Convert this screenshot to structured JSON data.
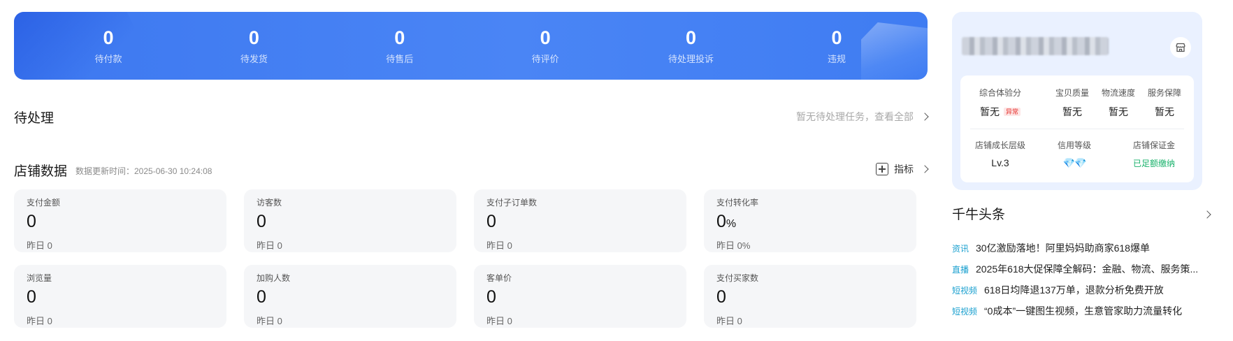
{
  "banner": {
    "items": [
      {
        "value": "0",
        "label": "待付款"
      },
      {
        "value": "0",
        "label": "待发货"
      },
      {
        "value": "0",
        "label": "待售后"
      },
      {
        "value": "0",
        "label": "待评价"
      },
      {
        "value": "0",
        "label": "待处理投诉"
      },
      {
        "value": "0",
        "label": "违规"
      }
    ]
  },
  "pending": {
    "title": "待处理",
    "link": "暂无待处理任务，查看全部"
  },
  "store": {
    "title": "店铺数据",
    "update_time": "数据更新时间：2025-06-30 10:24:08",
    "metric_link": "指标",
    "cards": [
      {
        "label": "支付金额",
        "value": "0",
        "unit": "",
        "yesterday": "昨日 0"
      },
      {
        "label": "访客数",
        "value": "0",
        "unit": "",
        "yesterday": "昨日 0"
      },
      {
        "label": "支付子订单数",
        "value": "0",
        "unit": "",
        "yesterday": "昨日 0"
      },
      {
        "label": "支付转化率",
        "value": "0",
        "unit": "%",
        "yesterday": "昨日 0%"
      },
      {
        "label": "浏览量",
        "value": "0",
        "unit": "",
        "yesterday": "昨日 0"
      },
      {
        "label": "加购人数",
        "value": "0",
        "unit": "",
        "yesterday": "昨日 0"
      },
      {
        "label": "客单价",
        "value": "0",
        "unit": "",
        "yesterday": "昨日 0"
      },
      {
        "label": "支付买家数",
        "value": "0",
        "unit": "",
        "yesterday": "昨日 0"
      }
    ]
  },
  "shop": {
    "icon": "shop-icon",
    "scores_row1": [
      {
        "label": "综合体验分",
        "value": "暂无",
        "tag": "异常"
      },
      {
        "label": "宝贝质量",
        "value": "暂无"
      },
      {
        "label": "物流速度",
        "value": "暂无"
      },
      {
        "label": "服务保障",
        "value": "暂无"
      }
    ],
    "scores_row2": [
      {
        "label": "店铺成长层级",
        "value": "Lv.3"
      },
      {
        "label": "信用等级",
        "value": "💎💎"
      },
      {
        "label": "店铺保证金",
        "value": "已足额缴纳"
      }
    ],
    "accent_green": "#19b26b"
  },
  "news": {
    "title": "千牛头条",
    "items": [
      {
        "tag": "资讯",
        "text": "30亿激励落地！阿里妈妈助商家618爆单"
      },
      {
        "tag": "直播",
        "text": "2025年618大促保障全解码：金融、物流、服务策..."
      },
      {
        "tag": "短视频",
        "text": "618日均降退137万单，退款分析免费开放"
      },
      {
        "tag": "短视频",
        "text": "“0成本”一键图生视频，生意管家助力流量转化"
      }
    ]
  },
  "colors": {
    "banner": "#4a85f5",
    "card_bg": "#f5f6f8",
    "panel_bg": "#eaf1ff"
  }
}
